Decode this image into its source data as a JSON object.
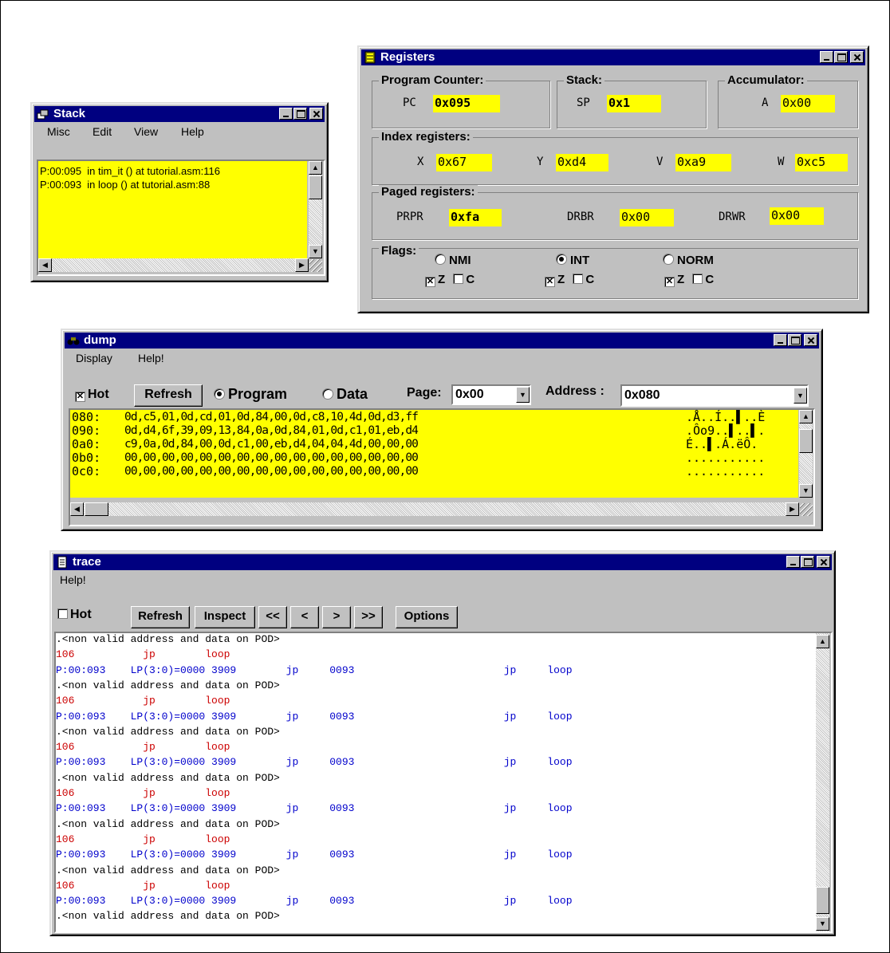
{
  "stack": {
    "title": "Stack",
    "menu": [
      "Misc",
      "Edit",
      "View",
      "Help"
    ],
    "lines": [
      "P:00:095  in tim_it () at tutorial.asm:116",
      "P:00:093  in loop () at tutorial.asm:88"
    ]
  },
  "registers": {
    "title": "Registers",
    "program_counter": {
      "label": "Program Counter:",
      "name": "PC",
      "value": "0x095"
    },
    "stack": {
      "label": "Stack:",
      "name": "SP",
      "value": "0x1"
    },
    "accumulator": {
      "label": "Accumulator:",
      "name": "A",
      "value": "0x00"
    },
    "index": {
      "label": "Index registers:",
      "regs": [
        {
          "name": "X",
          "value": "0x67"
        },
        {
          "name": "Y",
          "value": "0xd4"
        },
        {
          "name": "V",
          "value": "0xa9"
        },
        {
          "name": "W",
          "value": "0xc5"
        }
      ]
    },
    "paged": {
      "label": "Paged registers:",
      "regs": [
        {
          "name": "PRPR",
          "value": "0xfa"
        },
        {
          "name": "DRBR",
          "value": "0x00"
        },
        {
          "name": "DRWR",
          "value": "0x00"
        }
      ]
    },
    "flags": {
      "label": "Flags:",
      "modes": [
        {
          "name": "NMI",
          "selected": false
        },
        {
          "name": "INT",
          "selected": true
        },
        {
          "name": "NORM",
          "selected": false
        }
      ],
      "z_label": "Z",
      "c_label": "C"
    }
  },
  "dump": {
    "title": "dump",
    "menu": [
      "Display",
      "Help!"
    ],
    "hot_label": "Hot",
    "hot_checked": true,
    "refresh_label": "Refresh",
    "program_label": "Program",
    "data_label": "Data",
    "page_label": "Page:",
    "page_value": "0x00",
    "address_label": "Address :",
    "address_value": "0x080",
    "rows": [
      {
        "addr": "080:",
        "bytes": "0d,c5,01,0d,cd,01,0d,84,00,0d,c8,10,4d,0d,d3,ff",
        "ascii": ".Å..Í..▌..È"
      },
      {
        "addr": "090:",
        "bytes": "0d,d4,6f,39,09,13,84,0a,0d,84,01,0d,c1,01,eb,d4",
        "ascii": ".Ôo9..▌..▌."
      },
      {
        "addr": "0a0:",
        "bytes": "c9,0a,0d,84,00,0d,c1,00,eb,d4,04,04,4d,00,00,00",
        "ascii": "É..▌.Á.ëÔ."
      },
      {
        "addr": "0b0:",
        "bytes": "00,00,00,00,00,00,00,00,00,00,00,00,00,00,00,00",
        "ascii": "..........."
      },
      {
        "addr": "0c0:",
        "bytes": "00,00,00,00,00,00,00,00,00,00,00,00,00,00,00,00",
        "ascii": "..........."
      }
    ]
  },
  "trace": {
    "title": "trace",
    "menu": [
      "Help!"
    ],
    "hot_label": "Hot",
    "buttons": [
      "Refresh",
      "Inspect",
      "<<",
      "<",
      ">",
      ">>",
      "Options"
    ],
    "lines": [
      {
        "text": ".<non valid address and data on POD>",
        "color": "#000000"
      },
      {
        "text": "106           jp        loop",
        "color": "#cc0000"
      },
      {
        "text": "P:00:093    LP(3:0)=0000 3909        jp     0093                        jp     loop",
        "color": "#0000cc"
      },
      {
        "text": ".<non valid address and data on POD>",
        "color": "#000000"
      },
      {
        "text": "106           jp        loop",
        "color": "#cc0000"
      },
      {
        "text": "P:00:093    LP(3:0)=0000 3909        jp     0093                        jp     loop",
        "color": "#0000cc"
      },
      {
        "text": ".<non valid address and data on POD>",
        "color": "#000000"
      },
      {
        "text": "106           jp        loop",
        "color": "#cc0000"
      },
      {
        "text": "P:00:093    LP(3:0)=0000 3909        jp     0093                        jp     loop",
        "color": "#0000cc"
      },
      {
        "text": ".<non valid address and data on POD>",
        "color": "#000000"
      },
      {
        "text": "106           jp        loop",
        "color": "#cc0000"
      },
      {
        "text": "P:00:093    LP(3:0)=0000 3909        jp     0093                        jp     loop",
        "color": "#0000cc"
      },
      {
        "text": ".<non valid address and data on POD>",
        "color": "#000000"
      },
      {
        "text": "106           jp        loop",
        "color": "#cc0000"
      },
      {
        "text": "P:00:093    LP(3:0)=0000 3909        jp     0093                        jp     loop",
        "color": "#0000cc"
      },
      {
        "text": ".<non valid address and data on POD>",
        "color": "#000000"
      },
      {
        "text": "106           jp        loop",
        "color": "#cc0000"
      },
      {
        "text": "P:00:093    LP(3:0)=0000 3909        jp     0093                        jp     loop",
        "color": "#0000cc"
      },
      {
        "text": ".<non valid address and data on POD>",
        "color": "#000000"
      }
    ]
  }
}
